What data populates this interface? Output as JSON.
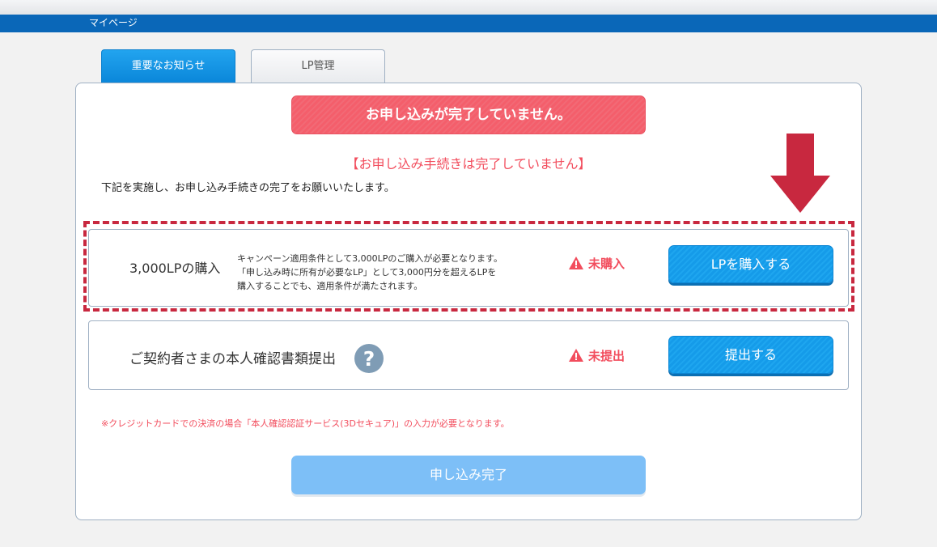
{
  "header": {
    "title": "マイページ"
  },
  "tabs": [
    {
      "label": "重要なお知らせ",
      "active": true
    },
    {
      "label": "LP管理",
      "active": false
    }
  ],
  "main": {
    "alert_banner": "お申し込みが完了していません。",
    "subheading": "【お申し込み手続きは完了していません】",
    "description": "下記を実施し、お申し込み手続きの完了をお願いいたします。",
    "tasks": [
      {
        "title": "3,000LPの購入",
        "desc_lines": [
          "キャンペーン適用条件として3,000LPのご購入が必要となります。",
          "「申し込み時に所有が必要なLP」として3,000円分を超えるLPを",
          "購入することでも、適用条件が満たされます。"
        ],
        "status": "未購入",
        "button": "LPを購入する"
      },
      {
        "title": "ご契約者さまの本人確認書類提出",
        "status": "未提出",
        "button": "提出する"
      }
    ],
    "note": "※クレジットカードでの決済の場合「本人確認認証サービス(3Dセキュア)」の入力が必要となります。",
    "complete_button": "申し込み完了"
  },
  "colors": {
    "brand_blue": "#0a67b8",
    "button_blue": "#159be9",
    "alert_red": "#f45e6b",
    "highlight_crimson": "#c8283f",
    "disabled_blue": "#7dbff7"
  },
  "icons": [
    "warning-icon",
    "help-icon",
    "down-arrow-annotation"
  ]
}
